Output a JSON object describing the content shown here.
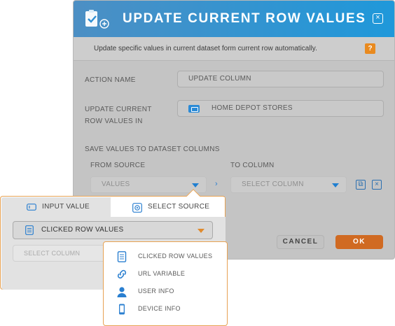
{
  "dialog": {
    "title": "UPDATE CURRENT ROW VALUES",
    "close_symbol": "×",
    "subtitle": "Update specific values in current dataset form current row automatically.",
    "help_symbol": "?",
    "action_name": {
      "label": "ACTION NAME",
      "value": "UPDATE COLUMN"
    },
    "update_row": {
      "label_line1": "UPDATE CURRENT",
      "label_line2": "ROW VALUES IN",
      "value": "HOME DEPOT STORES"
    },
    "save_values_label": "SAVE VALUES TO DATASET COLUMNS",
    "from_source": {
      "label": "FROM SOURCE",
      "value": "VALUES"
    },
    "to_column": {
      "label": "TO COLUMN",
      "placeholder": "SELECT COLUMN"
    },
    "arrow_symbol": "›",
    "copy_symbol": "⧉",
    "delete_symbol": "×",
    "cancel_label": "CANCEL",
    "ok_label": "OK"
  },
  "popup": {
    "tabs": [
      {
        "label": "INPUT VALUE",
        "active": false
      },
      {
        "label": "SELECT SOURCE",
        "active": true
      }
    ],
    "source_value": "CLICKED ROW VALUES",
    "column_placeholder": "SELECT COLUMN"
  },
  "menu": {
    "items": [
      {
        "label": "CLICKED ROW VALUES",
        "icon": "document-icon"
      },
      {
        "label": "URL VARIABLE",
        "icon": "link-icon"
      },
      {
        "label": "USER INFO",
        "icon": "user-icon"
      },
      {
        "label": "DEVICE INFO",
        "icon": "phone-icon"
      }
    ]
  },
  "colors": {
    "header_start": "#4c8fc4",
    "header_end": "#1f98da",
    "accent_blue": "#1f7fd1",
    "accent_orange": "#e98a1f",
    "ok_button": "#d06a22"
  }
}
